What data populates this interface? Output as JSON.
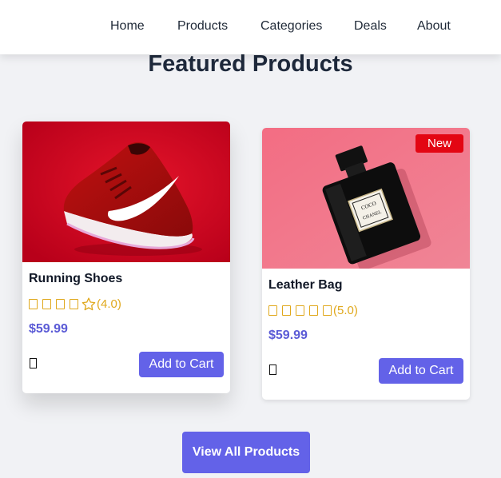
{
  "nav": {
    "items": [
      {
        "label": "Home"
      },
      {
        "label": "Products"
      },
      {
        "label": "Categories"
      },
      {
        "label": "Deals"
      },
      {
        "label": "About"
      }
    ]
  },
  "section": {
    "title": "Featured Products"
  },
  "products": [
    {
      "name": "Running Shoes",
      "rating_text": "(4.0)",
      "rating": 4,
      "price": "$59.99",
      "cart_label": "Add to Cart",
      "image_icon": "running-shoe-photo",
      "image_bg": "#d0021b"
    },
    {
      "name": "Leather Bag",
      "badge": "New",
      "rating_text": "(5.0)",
      "rating": 5,
      "price": "$59.99",
      "cart_label": "Add to Cart",
      "image_icon": "perfume-bottle-photo",
      "image_bg": "#f07c8c"
    }
  ],
  "footer": {
    "view_all_label": "View All Products"
  },
  "colors": {
    "accent": "#6362e8",
    "price": "#5b5bd6",
    "star": "#e0a81c",
    "badge": "#e30613",
    "background": "#f1f2f5"
  }
}
